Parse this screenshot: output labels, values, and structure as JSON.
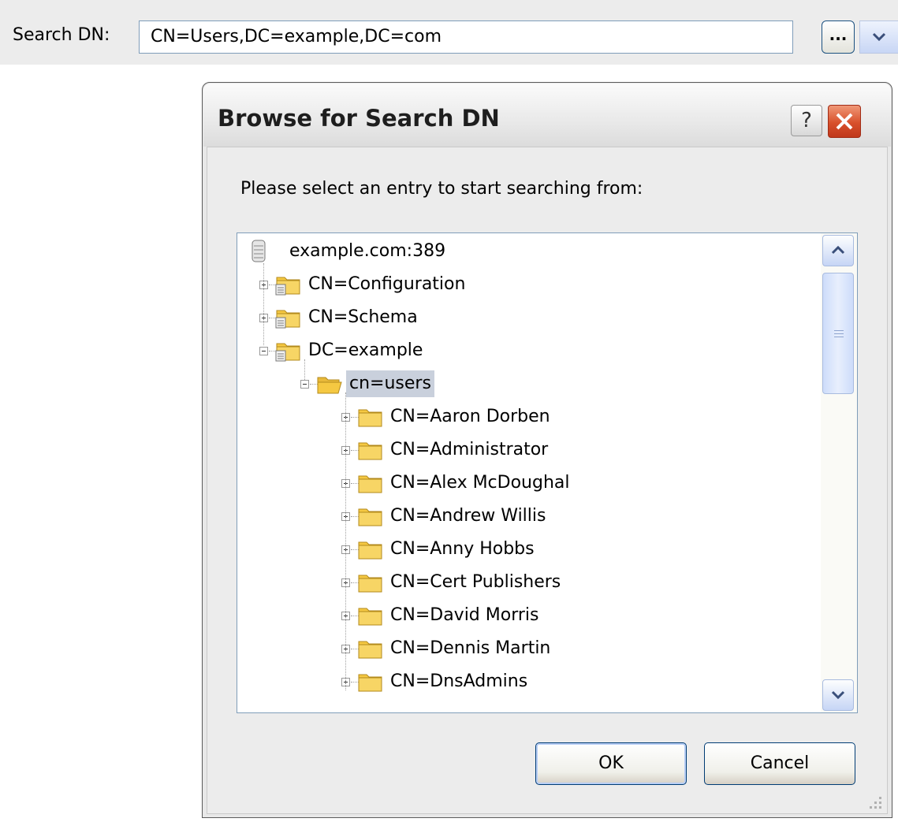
{
  "search": {
    "label": "Search DN:",
    "value": "CN=Users,DC=example,DC=com",
    "browse_label": "..."
  },
  "dialog": {
    "title": "Browse for Search DN",
    "help_label": "?",
    "prompt": "Please select an entry to start searching from:",
    "ok_label": "OK",
    "cancel_label": "Cancel"
  },
  "tree": {
    "root": "example.com:389",
    "items": [
      {
        "label": "CN=Configuration",
        "level": 1,
        "state": "collapsed",
        "icon": "container-icon"
      },
      {
        "label": "CN=Schema",
        "level": 1,
        "state": "collapsed",
        "icon": "container-icon"
      },
      {
        "label": "DC=example",
        "level": 1,
        "state": "expanded",
        "icon": "container-icon"
      },
      {
        "label": "cn=users",
        "level": 2,
        "state": "expanded",
        "icon": "open-folder-icon",
        "selected": true
      },
      {
        "label": "CN=Aaron Dorben",
        "level": 3,
        "state": "collapsed",
        "icon": "folder-icon"
      },
      {
        "label": "CN=Administrator",
        "level": 3,
        "state": "collapsed",
        "icon": "folder-icon"
      },
      {
        "label": "CN=Alex McDoughal",
        "level": 3,
        "state": "collapsed",
        "icon": "folder-icon"
      },
      {
        "label": "CN=Andrew Willis",
        "level": 3,
        "state": "collapsed",
        "icon": "folder-icon"
      },
      {
        "label": "CN=Anny Hobbs",
        "level": 3,
        "state": "collapsed",
        "icon": "folder-icon"
      },
      {
        "label": "CN=Cert Publishers",
        "level": 3,
        "state": "collapsed",
        "icon": "folder-icon"
      },
      {
        "label": "CN=David Morris",
        "level": 3,
        "state": "collapsed",
        "icon": "folder-icon"
      },
      {
        "label": "CN=Dennis Martin",
        "level": 3,
        "state": "collapsed",
        "icon": "folder-icon"
      },
      {
        "label": "CN=DnsAdmins",
        "level": 3,
        "state": "collapsed",
        "icon": "folder-icon"
      }
    ]
  },
  "colors": {
    "selection": "#c9d0dc",
    "folder": "#f5c842",
    "close_button": "#d8502b"
  }
}
